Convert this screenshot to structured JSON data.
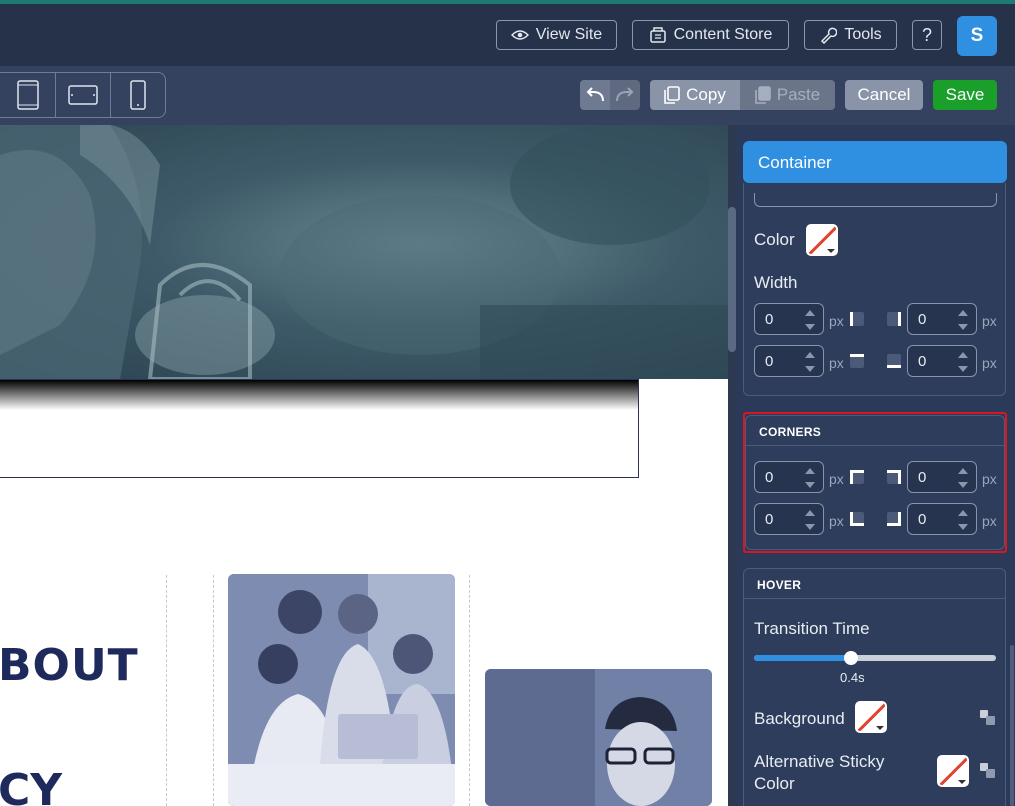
{
  "topbar": {
    "view_site": "View Site",
    "content_store": "Content Store",
    "tools": "Tools",
    "help": "?",
    "avatar_initial": "S"
  },
  "toolbar": {
    "copy": "Copy",
    "paste": "Paste",
    "cancel": "Cancel",
    "save": "Save"
  },
  "canvas": {
    "heading_about": "BOUT",
    "heading_cy": "CY"
  },
  "panel": {
    "title": "Container",
    "border": {
      "color_label": "Color",
      "width_label": "Width",
      "top_left": "0",
      "top_right": "0",
      "bottom_left": "0",
      "bottom_right": "0",
      "unit": "px"
    },
    "corners": {
      "title": "CORNERS",
      "top_left": "0",
      "top_right": "0",
      "bottom_left": "0",
      "bottom_right": "0",
      "unit": "px"
    },
    "hover": {
      "title": "HOVER",
      "transition_label": "Transition Time",
      "transition_value": "0.4s",
      "transition_fraction": 0.4,
      "background_label": "Background",
      "alt_sticky_label_1": "Alternative Sticky",
      "alt_sticky_label_2": "Color"
    }
  },
  "colors": {
    "accent_blue": "#2f8fe0",
    "save_green": "#1aa02a",
    "highlight_red": "#e0141c",
    "heading_navy": "#1f2a5c"
  }
}
